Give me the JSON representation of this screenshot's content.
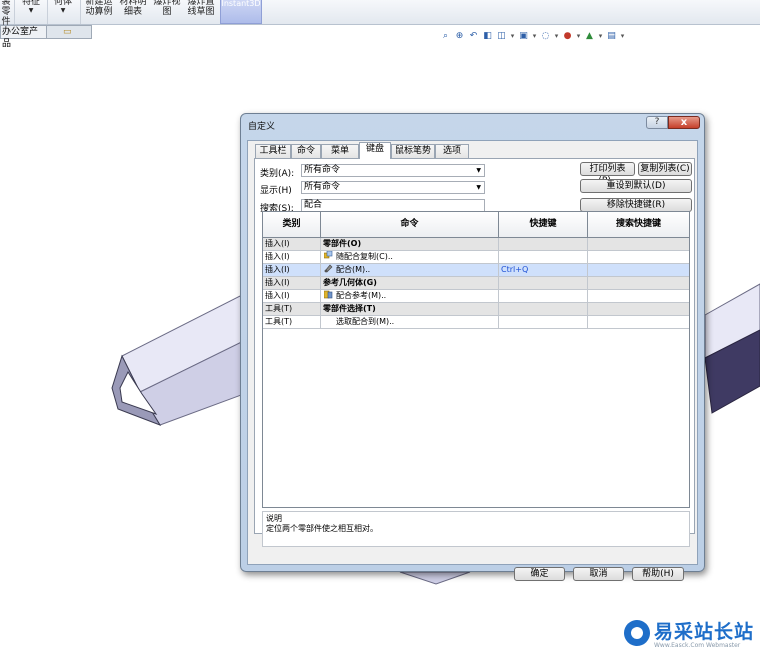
{
  "ribbon": {
    "items": [
      {
        "label": "装\n零\n件",
        "has_arrow": false
      },
      {
        "label": "特征",
        "has_arrow": true
      },
      {
        "label": "何体",
        "has_arrow": true
      },
      {
        "label": "新建运\n动算例",
        "has_arrow": false
      },
      {
        "label": "材料明\n细表",
        "has_arrow": false
      },
      {
        "label": "爆炸视\n图",
        "has_arrow": false
      },
      {
        "label": "爆炸直\n线草图",
        "has_arrow": false
      },
      {
        "label": "Instant3D",
        "has_arrow": false
      }
    ],
    "tabs": [
      "办公室产品"
    ]
  },
  "heads_up_icons": [
    "zoom-to-fit-icon",
    "zoom-area-icon",
    "previous-view-icon",
    "section-view-icon",
    "view-orientation-icon",
    "display-style-icon",
    "hide-show-icon",
    "appearance-icon",
    "scene-icon",
    "view-settings-icon"
  ],
  "dialog": {
    "title": "自定义",
    "help_glyph": "?",
    "close_glyph": "x",
    "tabs": [
      "工具栏",
      "命令",
      "菜单",
      "键盘",
      "鼠标笔势",
      "选项"
    ],
    "active_tab": "键盘",
    "category_label": "类别(A):",
    "category_value": "所有命令",
    "show_label": "显示(H)",
    "show_value": "所有命令",
    "search_label": "搜索(S):",
    "search_value": "配合",
    "buttons_right": {
      "print": "打印列表(P)..",
      "copy": "复制列表(C)",
      "reset": "重设到默认(D)",
      "remove": "移除快捷键(R)"
    },
    "grid": {
      "columns": [
        "类别",
        "命令",
        "快捷键",
        "搜索快捷键"
      ],
      "rows": [
        {
          "category": "插入(I)",
          "command": "零部件(O)",
          "shortcut": "",
          "search": "",
          "kind": "header",
          "icon": ""
        },
        {
          "category": "插入(I)",
          "command": "随配合复制(C)..",
          "shortcut": "",
          "search": "",
          "kind": "normal",
          "icon": "copy-with-mates-icon"
        },
        {
          "category": "插入(I)",
          "command": "配合(M)..",
          "shortcut": "Ctrl+Q",
          "search": "",
          "kind": "selected",
          "icon": "mate-icon"
        },
        {
          "category": "插入(I)",
          "command": "参考几何体(G)",
          "shortcut": "",
          "search": "",
          "kind": "header",
          "icon": ""
        },
        {
          "category": "插入(I)",
          "command": "配合参考(M)..",
          "shortcut": "",
          "search": "",
          "kind": "normal",
          "icon": "mate-reference-icon"
        },
        {
          "category": "工具(T)",
          "command": "零部件选择(T)",
          "shortcut": "",
          "search": "",
          "kind": "header",
          "icon": ""
        },
        {
          "category": "工具(T)",
          "command": "选取配合到(M)..",
          "shortcut": "",
          "search": "",
          "kind": "normal",
          "icon": ""
        }
      ]
    },
    "description": {
      "heading": "说明",
      "text": "定位两个零部件使之相互相对。"
    },
    "footer": {
      "ok": "确定",
      "cancel": "取消",
      "help": "帮助(H)"
    }
  },
  "watermark": {
    "text": "易采站长站",
    "sub": "Www.Easck.Com Webmaster"
  },
  "colors": {
    "selection": "#cfe0fb",
    "shortcut_text": "#1c4fd6",
    "brand": "#1e6ec9"
  }
}
